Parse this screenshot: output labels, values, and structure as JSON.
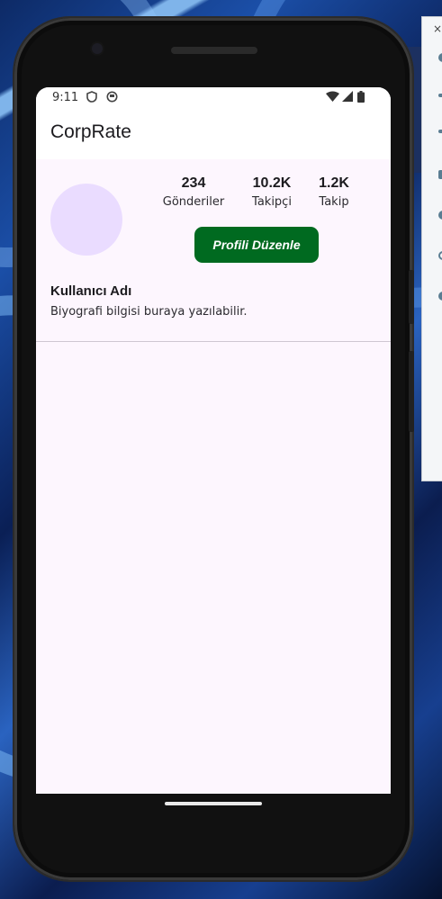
{
  "status_bar": {
    "time": "9:11",
    "left_icons": [
      "shield-icon",
      "circle-app-icon"
    ],
    "right_icons": [
      "wifi-icon",
      "cellular-signal-icon",
      "battery-icon"
    ]
  },
  "app_bar": {
    "title": "CorpRate"
  },
  "profile": {
    "stats": [
      {
        "value": "234",
        "label": "Gönderiler"
      },
      {
        "value": "10.2K",
        "label": "Takipçi"
      },
      {
        "value": "1.2K",
        "label": "Takip"
      }
    ],
    "edit_button_label": "Profili Düzenle",
    "username": "Kullanıcı Adı",
    "bio": "Biyografi bilgisi buraya yazılabilir."
  },
  "colors": {
    "accent": "#006a20",
    "avatar": "#eadcff",
    "screen_background": "#fdf6fe"
  }
}
